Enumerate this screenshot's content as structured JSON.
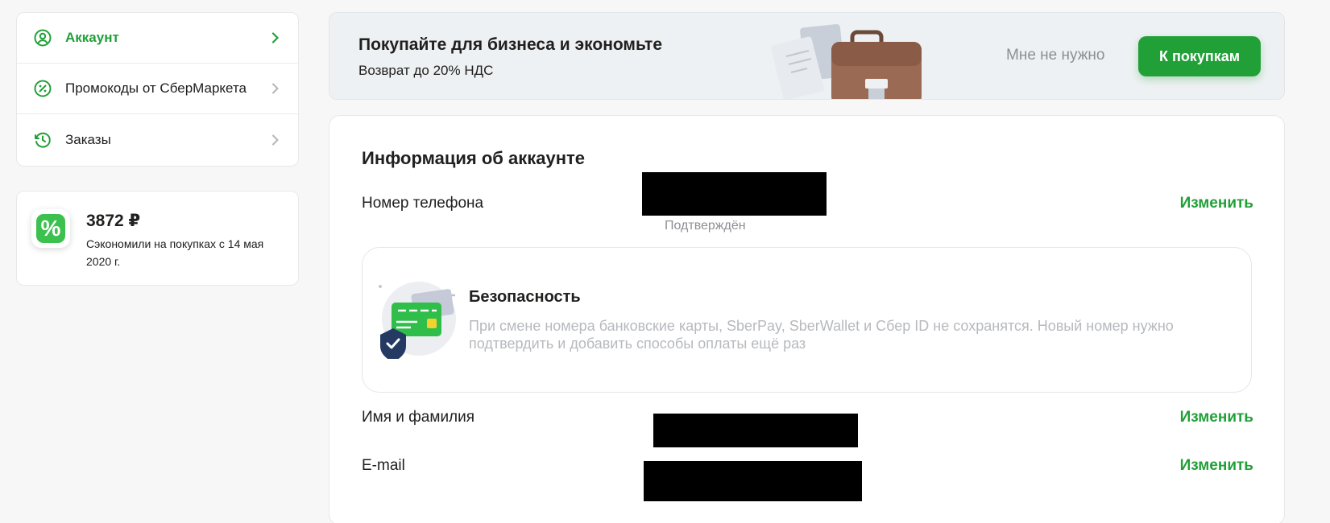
{
  "sidebar": {
    "items": [
      {
        "label": "Аккаунт",
        "icon": "user-circle-icon",
        "active": true
      },
      {
        "label": "Промокоды от СберМаркета",
        "icon": "percent-circle-icon",
        "active": false
      },
      {
        "label": "Заказы",
        "icon": "history-icon",
        "active": false
      }
    ]
  },
  "savings": {
    "badge": "%",
    "amount": "3872 ₽",
    "description": "Сэкономили на покупках с 14 мая 2020 г."
  },
  "banner": {
    "title": "Покупайте для бизнеса и экономьте",
    "subtitle": "Возврат до 20% НДС",
    "dismiss_label": "Мне не нужно",
    "cta_label": "К покупкам"
  },
  "account": {
    "heading": "Информация об аккаунте",
    "phone": {
      "label": "Номер телефона",
      "status": "Подтверждён",
      "edit_label": "Изменить"
    },
    "security": {
      "title": "Безопасность",
      "description": "При смене номера банковские карты, SberPay, SberWallet и Сбер ID не сохранятся. Новый номер нужно подтвердить и добавить способы оплаты ещё раз"
    },
    "name": {
      "label": "Имя и фамилия",
      "edit_label": "Изменить"
    },
    "email": {
      "label": "E-mail",
      "edit_label": "Изменить"
    }
  },
  "colors": {
    "accent": "#21a038",
    "muted": "#8d8f94",
    "page_bg": "#f7f7f7"
  }
}
